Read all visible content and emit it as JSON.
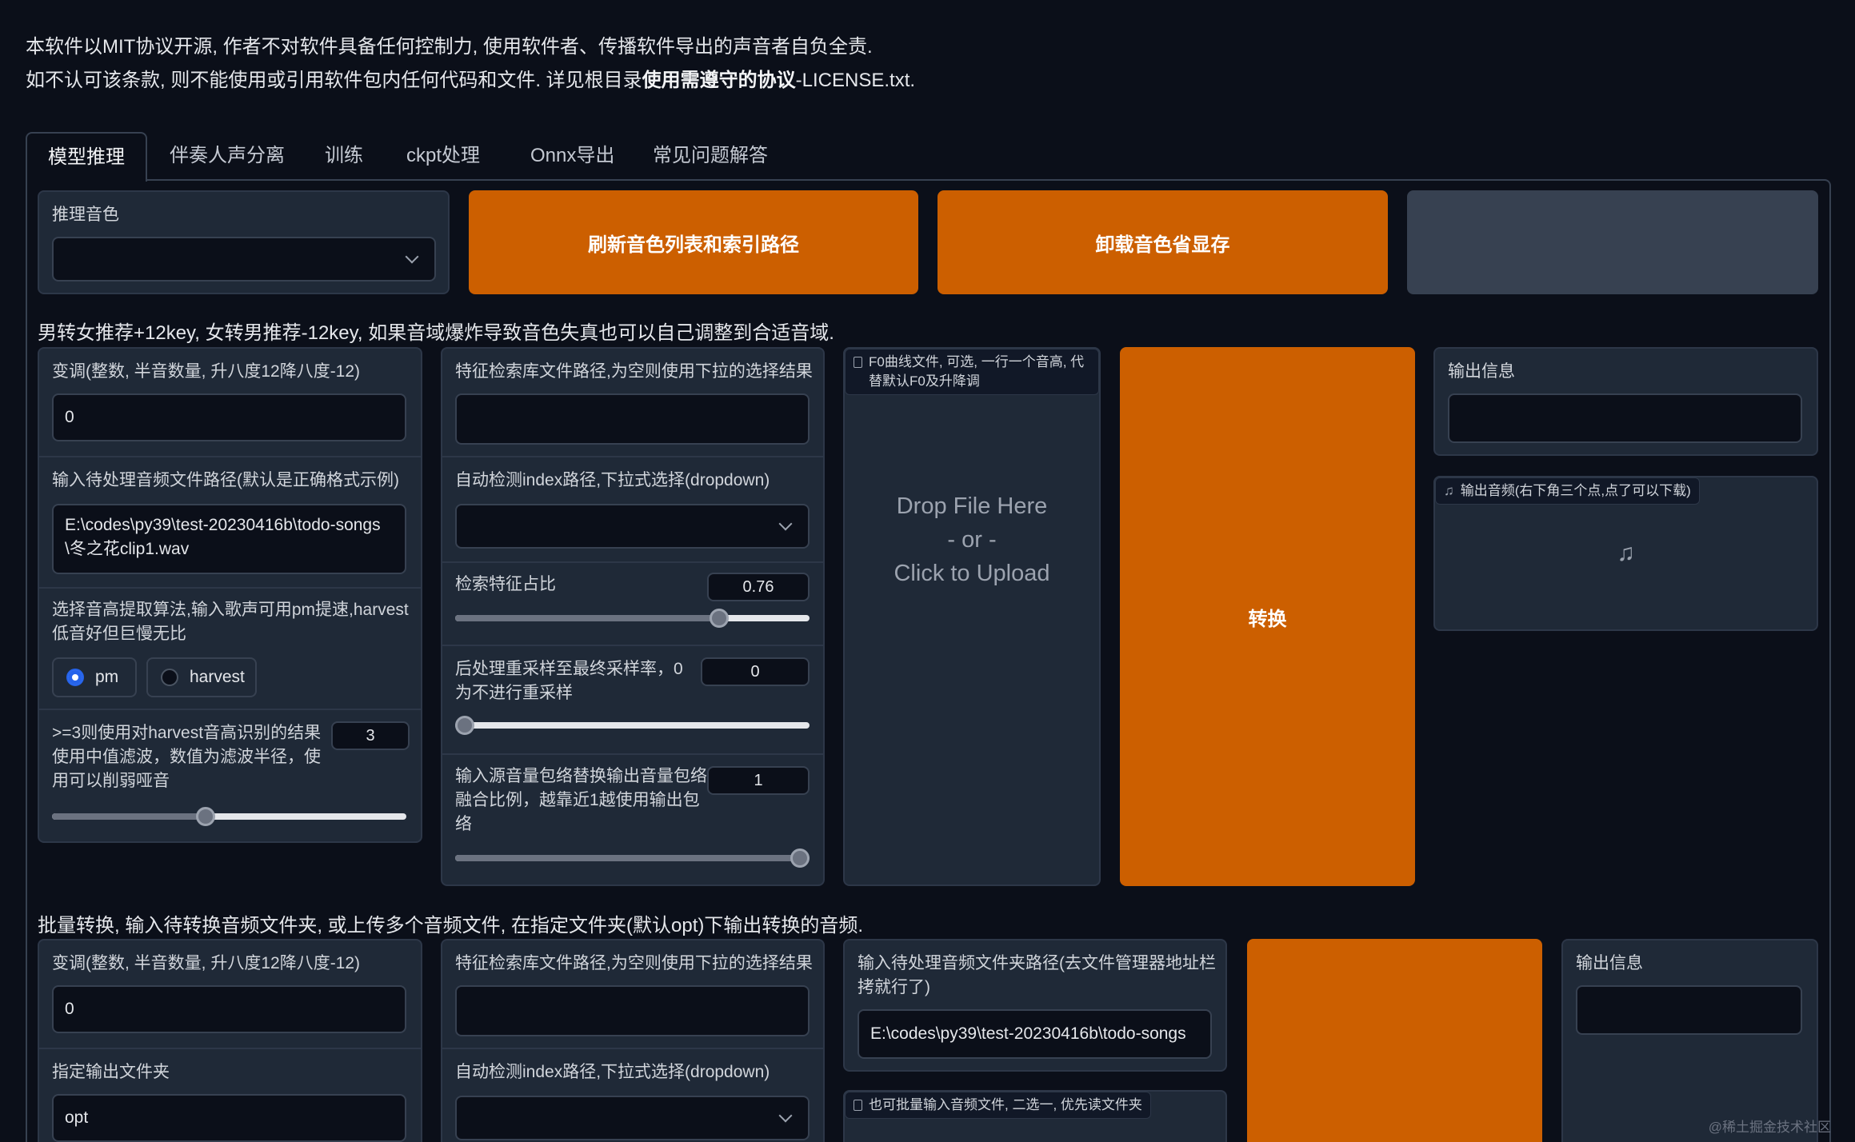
{
  "notice": {
    "line1": "本软件以MIT协议开源, 作者不对软件具备任何控制力, 使用软件者、传播软件导出的声音者自负全责.",
    "line2_prefix": "如不认可该条款, 则不能使用或引用软件包内任何代码和文件. 详见根目录",
    "line2_bold": "使用需遵守的协议",
    "line2_suffix": "-LICENSE.txt."
  },
  "tabs": [
    "模型推理",
    "伴奏人声分离",
    "训练",
    "ckpt处理",
    "Onnx导出",
    "常见问题解答"
  ],
  "top": {
    "voice_label": "推理音色",
    "voice_value": "",
    "refresh_button": "刷新音色列表和索引路径",
    "unload_button": "卸载音色省显存"
  },
  "hint_single": "男转女推荐+12key, 女转男推荐-12key, 如果音域爆炸导致音色失真也可以自己调整到合适音域.",
  "single": {
    "transpose_label": "变调(整数, 半音数量, 升八度12降八度-12)",
    "transpose_value": "0",
    "input_path_label": "输入待处理音频文件路径(默认是正确格式示例)",
    "input_path_value": "E:\\codes\\py39\\test-20230416b\\todo-songs\\冬之花clip1.wav",
    "pitch_algo_label": "选择音高提取算法,输入歌声可用pm提速,harvest低音好但巨慢无比",
    "pitch_options": [
      "pm",
      "harvest"
    ],
    "pitch_selected": "pm",
    "median_label": ">=3则使用对harvest音高识别的结果使用中值滤波，数值为滤波半径，使用可以削弱哑音",
    "median_value": "3",
    "median_fraction": 0.43,
    "index_path_label": "特征检索库文件路径,为空则使用下拉的选择结果",
    "index_path_value": "",
    "auto_index_label": "自动检测index路径,下拉式选择(dropdown)",
    "auto_index_value": "",
    "index_rate_label": "检索特征占比",
    "index_rate_value": "0.76",
    "index_rate_fraction": 0.76,
    "resample_label": "后处理重采样至最终采样率，0为不进行重采样",
    "resample_value": "0",
    "resample_fraction": 0.0,
    "rms_label": "输入源音量包络替换输出音量包络融合比例，越靠近1越使用输出包络",
    "rms_value": "1",
    "rms_fraction": 1.0,
    "f0_file_label": "F0曲线文件, 可选, 一行一个音高, 代替默认F0及升降调",
    "drop_line1": "Drop File Here",
    "drop_line2": "- or -",
    "drop_line3": "Click to Upload",
    "convert_button": "转换",
    "output_info_label": "输出信息",
    "output_info_value": "",
    "output_audio_label": "输出音频(右下角三个点,点了可以下载)"
  },
  "hint_batch": "批量转换, 输入待转换音频文件夹, 或上传多个音频文件, 在指定文件夹(默认opt)下输出转换的音频.",
  "batch": {
    "transpose_label": "变调(整数, 半音数量, 升八度12降八度-12)",
    "transpose_value": "0",
    "output_folder_label": "指定输出文件夹",
    "output_folder_value": "opt",
    "index_path_label": "特征检索库文件路径,为空则使用下拉的选择结果",
    "index_path_value": "",
    "auto_index_label": "自动检测index路径,下拉式选择(dropdown)",
    "auto_index_value": "",
    "folder_label": "输入待处理音频文件夹路径(去文件管理器地址栏拷就行了)",
    "folder_value": "E:\\codes\\py39\\test-20230416b\\todo-songs",
    "multi_file_label": "也可批量输入音频文件, 二选一, 优先读文件夹",
    "output_info_label": "输出信息",
    "output_info_value": ""
  },
  "watermark": "@稀土掘金技术社区"
}
